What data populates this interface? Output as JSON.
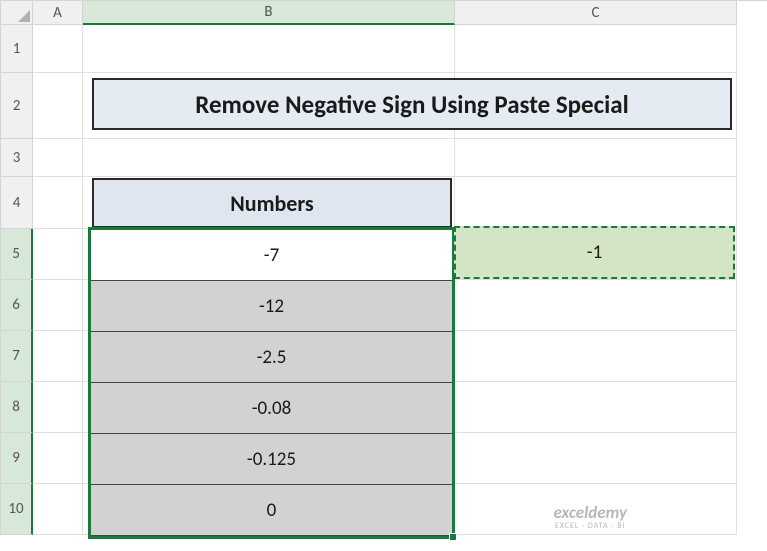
{
  "columns": [
    "A",
    "B",
    "C"
  ],
  "rows": [
    "1",
    "2",
    "3",
    "4",
    "5",
    "6",
    "7",
    "8",
    "9",
    "10"
  ],
  "title": "Remove Negative Sign Using Paste Special",
  "numbers_header": "Numbers",
  "data": [
    "-7",
    "-12",
    "-2.5",
    "-0.08",
    "-0.125",
    "0"
  ],
  "copied_value": "-1",
  "watermark": "exceldemy",
  "watermark_sub": "EXCEL · DATA · BI",
  "chart_data": {
    "type": "table",
    "title": "Remove Negative Sign Using Paste Special",
    "columns": [
      "Numbers"
    ],
    "rows": [
      [
        -7
      ],
      [
        -12
      ],
      [
        -2.5
      ],
      [
        -0.08
      ],
      [
        -0.125
      ],
      [
        0
      ]
    ],
    "aux_cell": {
      "ref": "C5",
      "value": -1,
      "state": "copied-marching-ants"
    },
    "selection": "B5:B10"
  }
}
